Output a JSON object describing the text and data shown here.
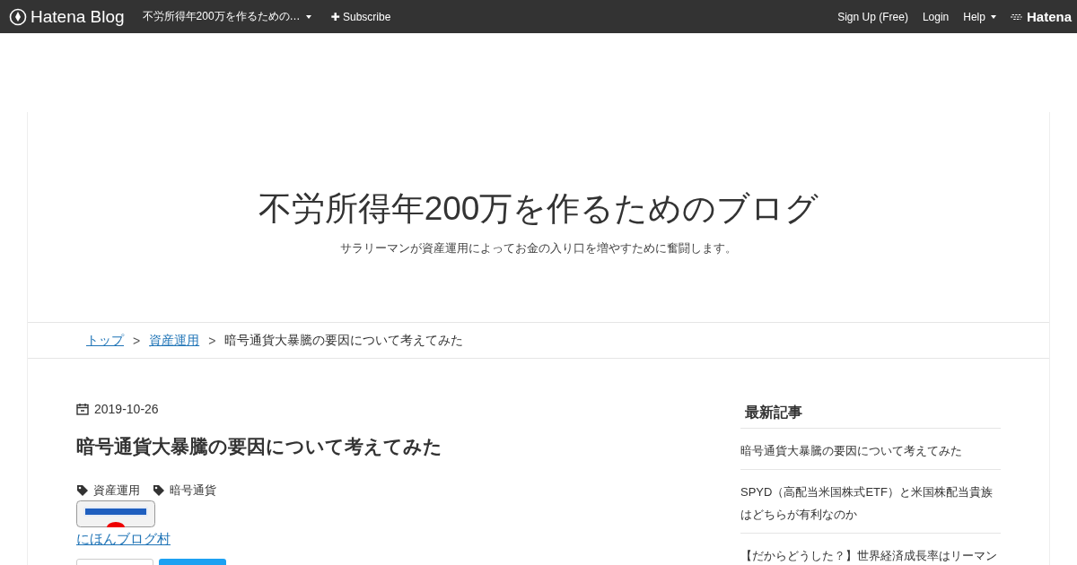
{
  "topbar": {
    "brand": "Hatena Blog",
    "blog_menu": "不労所得年200万を作るための…",
    "subscribe": "Subscribe",
    "subscribe_icon": "✚",
    "links": [
      "Sign Up (Free)",
      "Login"
    ],
    "help": "Help",
    "hatena": "Hatena"
  },
  "header": {
    "title": "不労所得年200万を作るためのブログ",
    "description": "サラリーマンが資産運用によってお金の入り口を増やすために奮闘します。"
  },
  "breadcrumb": {
    "items": [
      {
        "label": "トップ",
        "kind": "link"
      },
      {
        "label": "資産運用",
        "kind": "link"
      },
      {
        "label": "暗号通貨大暴騰の要因について考えてみた",
        "kind": "current"
      }
    ],
    "separator": ">"
  },
  "article": {
    "date": "2019-10-26",
    "title": "暗号通貨大暴騰の要因について考えてみた",
    "tags": [
      "資産運用",
      "暗号通貨"
    ],
    "banner": {
      "kind": "picture"
    },
    "banner_link": "にほんブログ村"
  },
  "sidebar": {
    "heading": "最新記事",
    "items": [
      "暗号通貨大暴騰の要因について考えてみた",
      "SPYD（高配当米国株式ETF）と米国株配当貴族はどちらが有利なのか",
      "【だからどうした？】世界経済成長率はリーマン"
    ]
  }
}
